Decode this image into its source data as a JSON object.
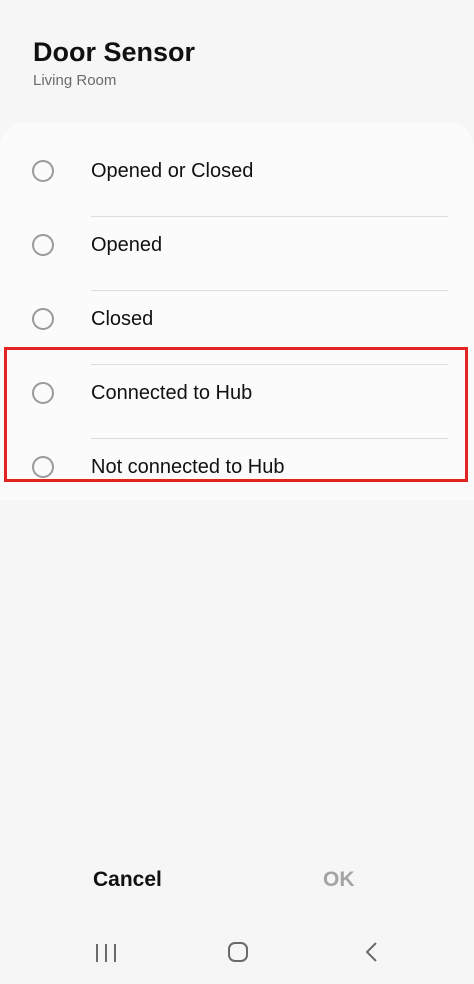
{
  "header": {
    "title": "Door Sensor",
    "subtitle": "Living Room"
  },
  "options": [
    {
      "label": "Opened or Closed",
      "selected": false
    },
    {
      "label": "Opened",
      "selected": false
    },
    {
      "label": "Closed",
      "selected": false
    },
    {
      "label": "Connected to Hub",
      "selected": false
    },
    {
      "label": "Not connected to Hub",
      "selected": false
    }
  ],
  "actions": {
    "cancel_label": "Cancel",
    "ok_label": "OK"
  },
  "nav": {
    "recent_icon": "recent-apps-icon",
    "home_icon": "home-icon",
    "back_icon": "back-icon"
  },
  "colors": {
    "highlight": "#e32222",
    "ok_disabled": "#a4a4a4",
    "background": "#f6f6f6"
  }
}
